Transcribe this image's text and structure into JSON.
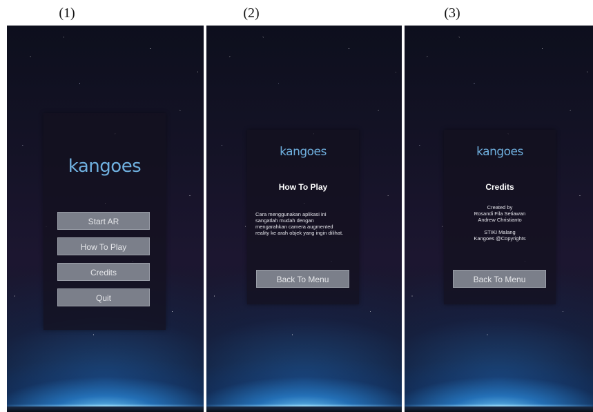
{
  "figure_labels": [
    "(1)",
    "(2)",
    "(3)"
  ],
  "screen1": {
    "logo": "kangoes",
    "buttons": {
      "start_ar": "Start AR",
      "how_to_play": "How To Play",
      "credits": "Credits",
      "quit": "Quit"
    }
  },
  "screen2": {
    "logo": "kangoes",
    "title": "How To Play",
    "lines": [
      "Cara menggunakan aplikasi ini",
      "sangatlah mudah dengan",
      "mengarahkan camera augmented",
      "reality ke arah objek yang ingin dilihat."
    ],
    "back_button": "Back To Menu"
  },
  "screen3": {
    "logo": "kangoes",
    "title": "Credits",
    "lines": [
      "Created by",
      "Rosandi Fila Setiawan",
      "Andrew Christianto",
      "",
      "STIKI Malang",
      "Kangoes @Copyrights"
    ],
    "back_button": "Back To Menu"
  },
  "colors": {
    "logo": "#6fb0df",
    "button_bg": "#7b7f8a",
    "panel_bg": "rgba(20,16,30,0.72)"
  }
}
